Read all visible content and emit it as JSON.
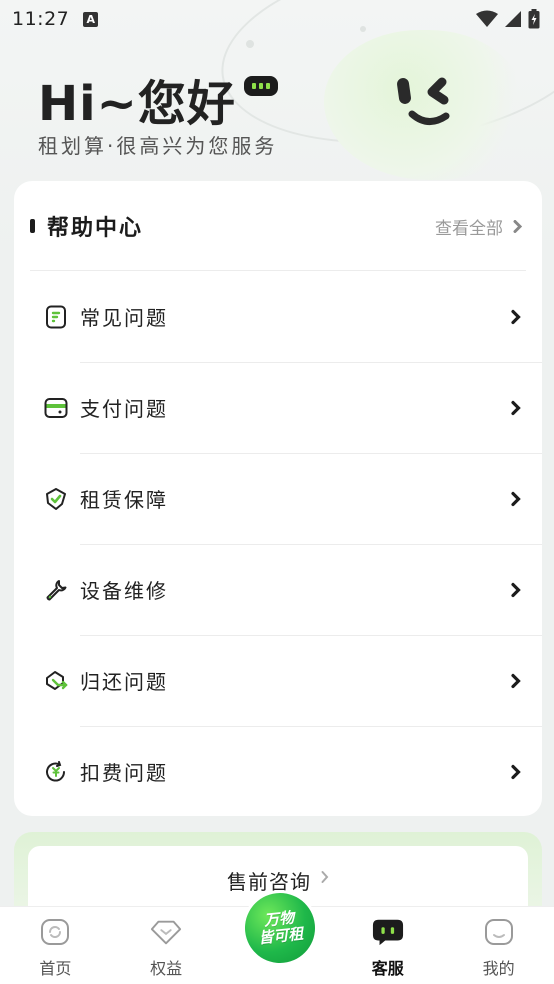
{
  "status_bar": {
    "time": "11:27",
    "badge": "A"
  },
  "hero": {
    "greeting": "Hi~您好",
    "subtitle": "租划算·很高兴为您服务"
  },
  "help_center": {
    "title": "帮助中心",
    "see_all": "查看全部",
    "items": [
      {
        "label": "常见问题",
        "icon": "faq-icon"
      },
      {
        "label": "支付问题",
        "icon": "wallet-icon"
      },
      {
        "label": "租赁保障",
        "icon": "shield-check-icon"
      },
      {
        "label": "设备维修",
        "icon": "wrench-icon"
      },
      {
        "label": "归还问题",
        "icon": "return-box-icon"
      },
      {
        "label": "扣费问题",
        "icon": "fee-icon"
      }
    ]
  },
  "presale": {
    "title": "售前咨询"
  },
  "tabbar": {
    "items": [
      {
        "label": "首页",
        "active": false
      },
      {
        "label": "权益",
        "active": false
      },
      {
        "label": "客服",
        "active": true
      },
      {
        "label": "我的",
        "active": false
      }
    ],
    "center": {
      "line1": "万物",
      "line2": "皆可租"
    }
  },
  "colors": {
    "accent": "#7ad03f",
    "brand_green": "#1fb84a",
    "text": "#1c1c1c"
  }
}
